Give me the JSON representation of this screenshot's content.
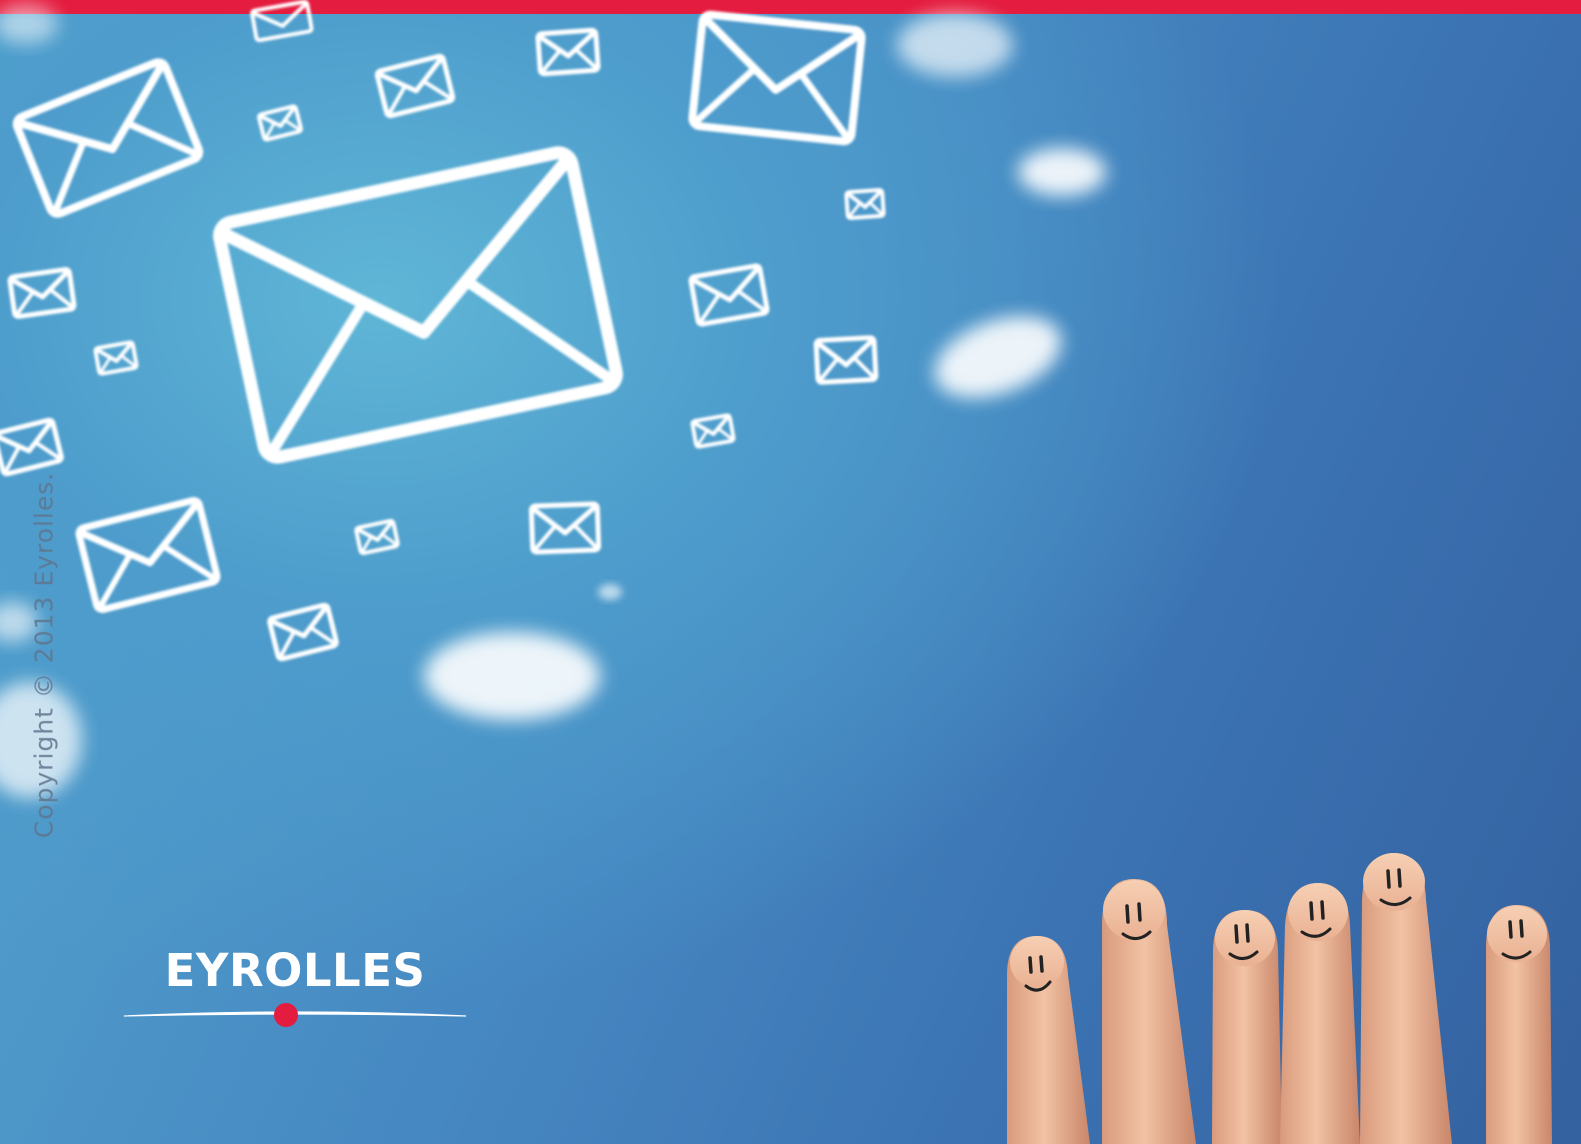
{
  "page": {
    "accent_color": "#e41c3f",
    "sky_color": "#4a8fc6"
  },
  "copyright": {
    "text": "Copyright © 2013 Eyrolles."
  },
  "logo": {
    "text": "EYROLLES",
    "dot_color": "#e41c3f"
  },
  "illustration": {
    "envelope_icon": "envelope-icon",
    "cloud_icon": "cloud-icon",
    "finger_icon": "smiling-finger"
  }
}
